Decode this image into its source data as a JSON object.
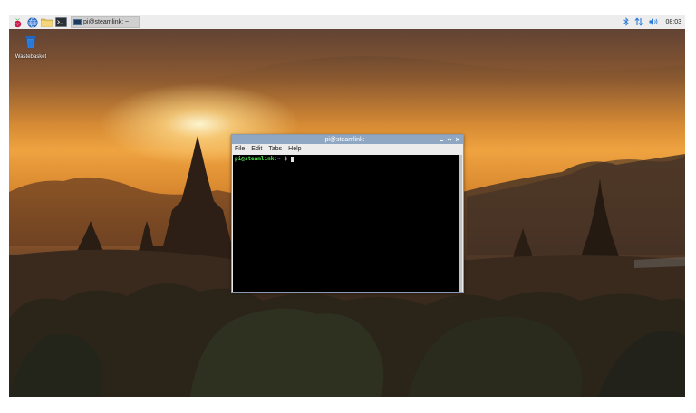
{
  "taskbar": {
    "launchers": [
      {
        "icon": "raspberry-menu-icon"
      },
      {
        "icon": "web-browser-icon"
      },
      {
        "icon": "file-manager-icon"
      },
      {
        "icon": "terminal-icon"
      }
    ],
    "task_button_label": "pi@steamlink: ~",
    "tray": {
      "bluetooth_icon": "bluetooth-icon",
      "network_icon": "network-transfer-icon",
      "volume_icon": "volume-icon",
      "clock": "08:03"
    }
  },
  "desktop": {
    "icons": [
      {
        "label": "Wastebasket",
        "icon": "wastebasket-icon"
      }
    ]
  },
  "terminal": {
    "title": "pi@steamlink: ~",
    "menu": [
      "File",
      "Edit",
      "Tabs",
      "Help"
    ],
    "prompt": {
      "user_host": "pi@steamlink",
      "separator": ":",
      "path": "~",
      "symbol": " $ "
    }
  },
  "colors": {
    "taskbar_bg": "#ededed",
    "titlebar_bg": "#8fa7c2",
    "terminal_bg": "#000000",
    "prompt_user": "#4ee44e",
    "prompt_path": "#6fa0ff"
  }
}
